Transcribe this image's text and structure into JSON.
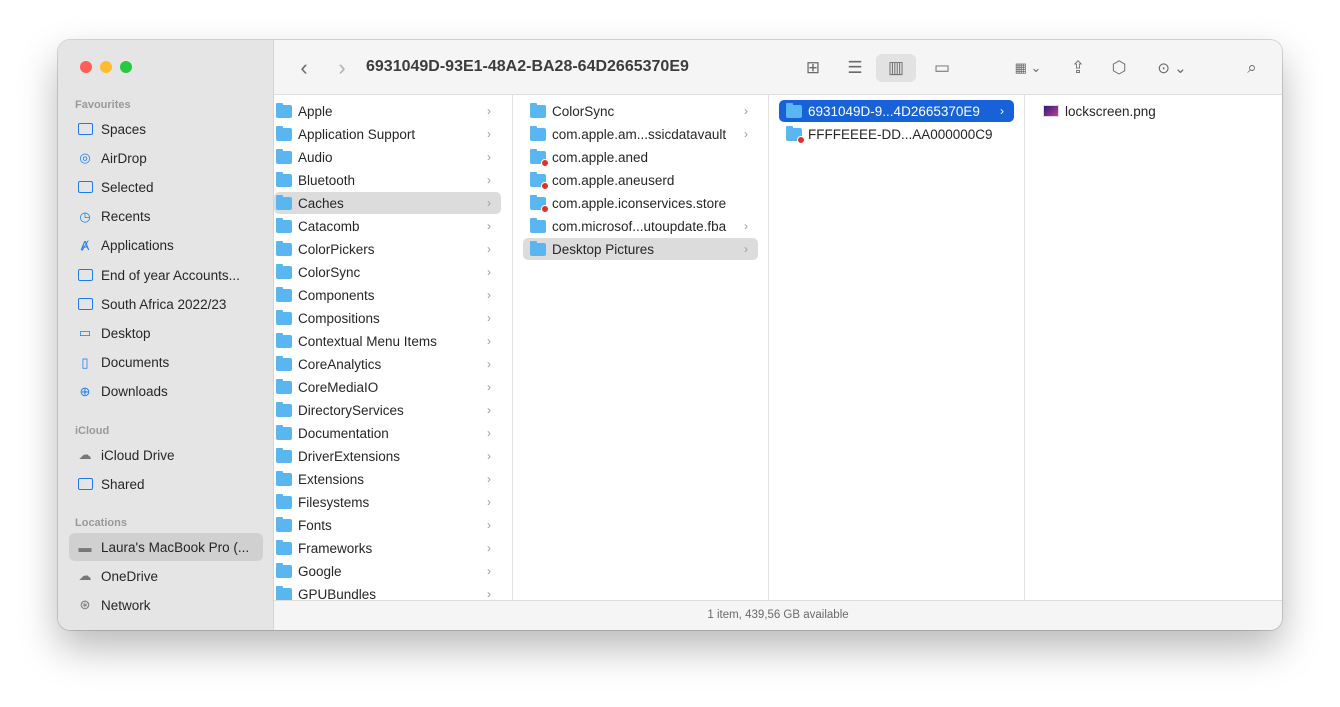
{
  "window": {
    "title": "6931049D-93E1-48A2-BA28-64D2665370E9",
    "status": "1 item, 439,56 GB available"
  },
  "sidebar": {
    "favourites_label": "Favourites",
    "icloud_label": "iCloud",
    "locations_label": "Locations",
    "favourites": [
      {
        "label": "Spaces",
        "icon": "folder-icon"
      },
      {
        "label": "AirDrop",
        "icon": "airdrop-icon"
      },
      {
        "label": "Selected",
        "icon": "folder-icon"
      },
      {
        "label": "Recents",
        "icon": "clock-icon"
      },
      {
        "label": "Applications",
        "icon": "applications-icon"
      },
      {
        "label": "End of year Accounts...",
        "icon": "folder-icon"
      },
      {
        "label": "South Africa 2022/23",
        "icon": "folder-icon"
      },
      {
        "label": "Desktop",
        "icon": "desktop-icon"
      },
      {
        "label": "Documents",
        "icon": "document-icon"
      },
      {
        "label": "Downloads",
        "icon": "download-icon"
      }
    ],
    "icloud": [
      {
        "label": "iCloud Drive",
        "icon": "cloud-icon"
      },
      {
        "label": "Shared",
        "icon": "shared-folder-icon"
      }
    ],
    "locations": [
      {
        "label": "Laura's MacBook Pro (...",
        "icon": "laptop-icon",
        "selected": true
      },
      {
        "label": "OneDrive",
        "icon": "cloud-icon"
      },
      {
        "label": "Network",
        "icon": "globe-icon"
      }
    ]
  },
  "columns": [
    {
      "items": [
        {
          "label": "Apple"
        },
        {
          "label": "Application Support"
        },
        {
          "label": "Audio"
        },
        {
          "label": "Bluetooth"
        },
        {
          "label": "Caches",
          "state": "highlight"
        },
        {
          "label": "Catacomb"
        },
        {
          "label": "ColorPickers"
        },
        {
          "label": "ColorSync"
        },
        {
          "label": "Components"
        },
        {
          "label": "Compositions"
        },
        {
          "label": "Contextual Menu Items"
        },
        {
          "label": "CoreAnalytics"
        },
        {
          "label": "CoreMediaIO"
        },
        {
          "label": "DirectoryServices"
        },
        {
          "label": "Documentation"
        },
        {
          "label": "DriverExtensions"
        },
        {
          "label": "Extensions"
        },
        {
          "label": "Filesystems"
        },
        {
          "label": "Fonts"
        },
        {
          "label": "Frameworks"
        },
        {
          "label": "Google"
        },
        {
          "label": "GPUBundles"
        }
      ]
    },
    {
      "items": [
        {
          "label": "ColorSync"
        },
        {
          "label": "com.apple.am...ssicdatavault"
        },
        {
          "label": "com.apple.aned",
          "restricted": true,
          "leaf": true
        },
        {
          "label": "com.apple.aneuserd",
          "restricted": true,
          "leaf": true
        },
        {
          "label": "com.apple.iconservices.store",
          "restricted": true,
          "leaf": true
        },
        {
          "label": "com.microsof...utoupdate.fba"
        },
        {
          "label": "Desktop Pictures",
          "state": "highlight"
        }
      ]
    },
    {
      "items": [
        {
          "label": "6931049D-9...4D2665370E9",
          "state": "active"
        },
        {
          "label": "FFFFEEEE-DD...AA000000C9",
          "restricted": true,
          "leaf": true
        }
      ]
    },
    {
      "items": [
        {
          "label": "lockscreen.png",
          "type": "image",
          "leaf": true
        }
      ]
    }
  ]
}
